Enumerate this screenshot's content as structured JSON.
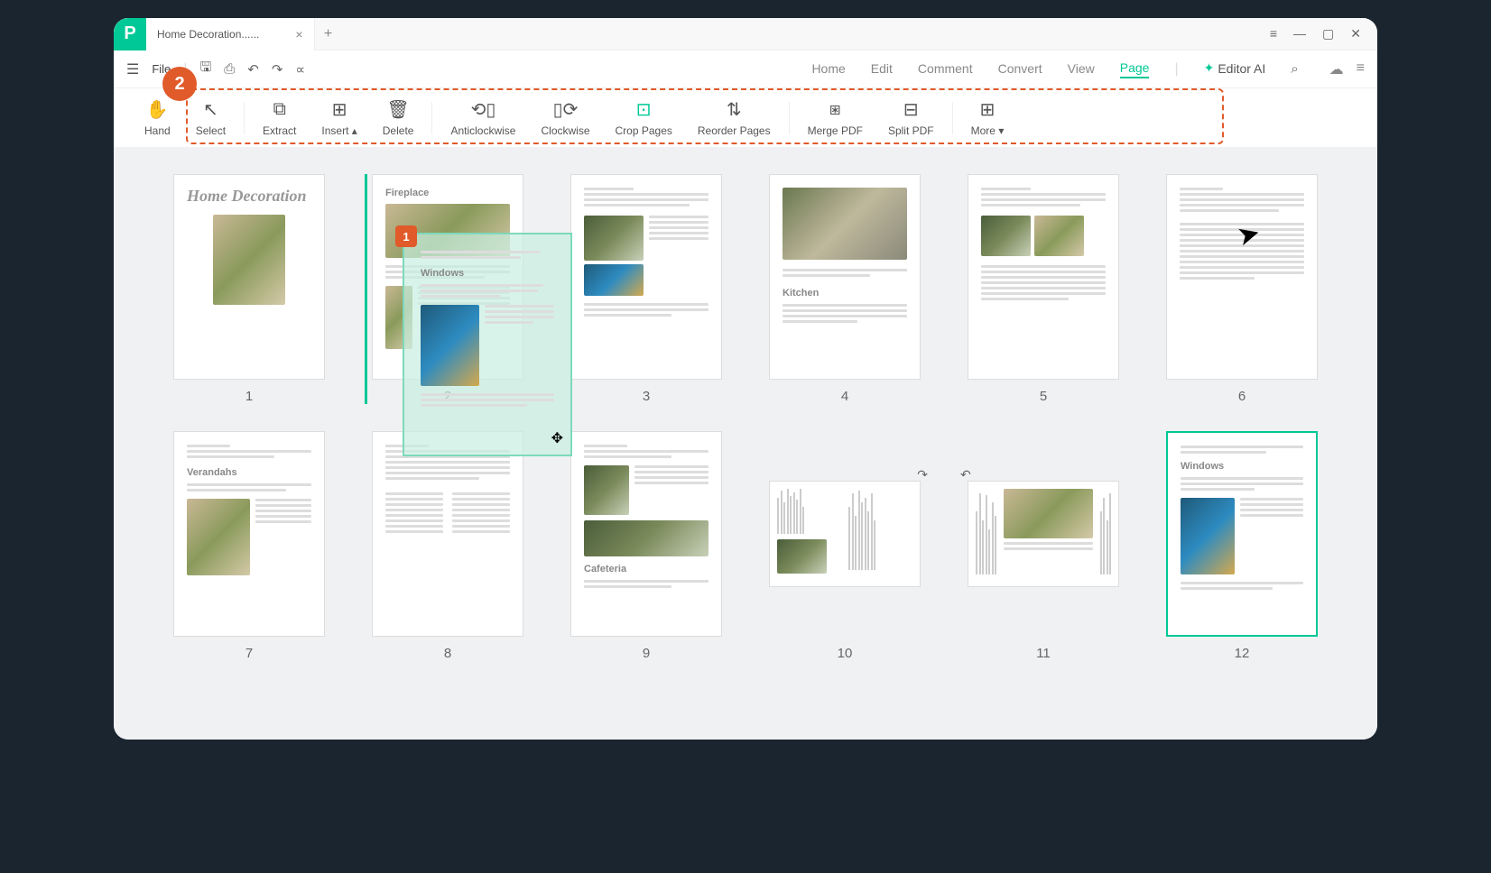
{
  "titlebar": {
    "tab_title": "Home Decoration......",
    "close": "×",
    "newtab": "+"
  },
  "wincontrols": {
    "menu": "≡",
    "min": "—",
    "max": "▢",
    "close": "✕"
  },
  "menubar": {
    "file": "File",
    "tabs": {
      "home": "Home",
      "edit": "Edit",
      "comment": "Comment",
      "convert": "Convert",
      "view": "View",
      "page": "Page"
    },
    "editor_ai": "Editor AI"
  },
  "toolbar": {
    "hand": "Hand",
    "select": "Select",
    "extract": "Extract",
    "insert": "Insert",
    "delete": "Delete",
    "anticlockwise": "Anticlockwise",
    "clockwise": "Clockwise",
    "crop": "Crop Pages",
    "reorder": "Reorder Pages",
    "merge": "Merge PDF",
    "split": "Split PDF",
    "more": "More"
  },
  "badge2": "2",
  "pages": {
    "cover_title": "Home Decoration",
    "p2_title": "Fireplace",
    "p4_title": "Kitchen",
    "p7_title": "Verandahs",
    "p9_title": "Cafeteria",
    "p12_title": "Windows",
    "drag_title": "Windows",
    "drag_badge": "1",
    "n1": "1",
    "n2": "2",
    "n3": "3",
    "n4": "4",
    "n5": "5",
    "n6": "6",
    "n7": "7",
    "n8": "8",
    "n9": "9",
    "n10": "10",
    "n11": "11",
    "n12": "12"
  }
}
